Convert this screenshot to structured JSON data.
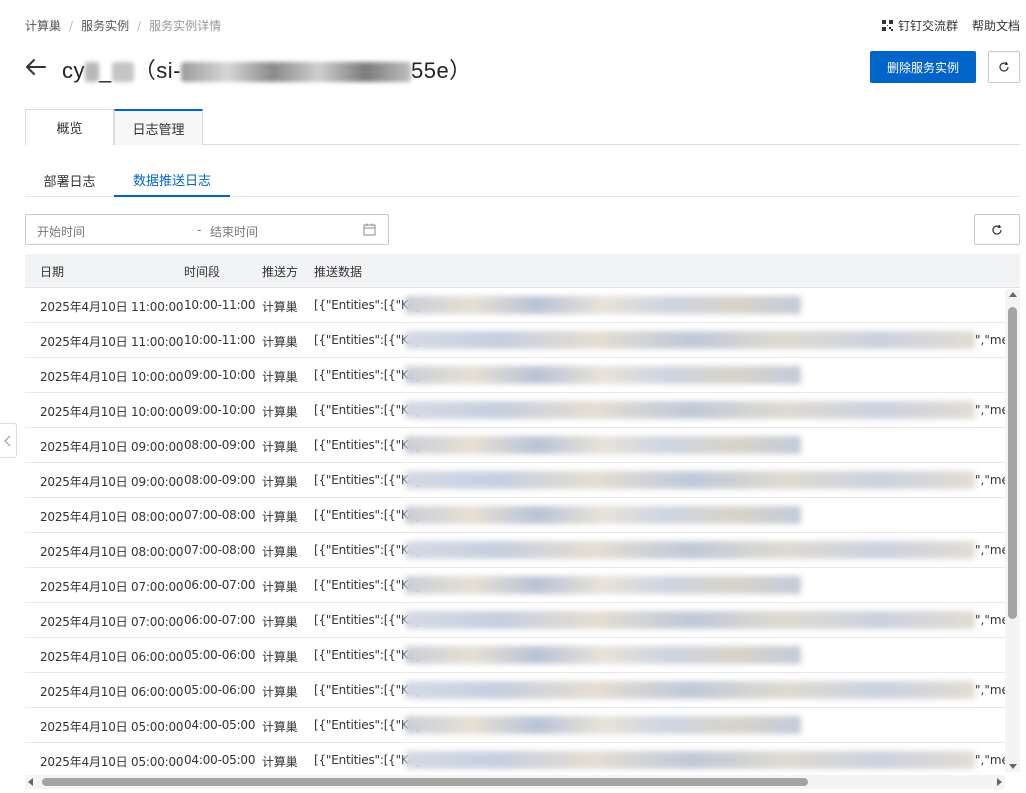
{
  "breadcrumb": {
    "items": [
      "计算巢",
      "服务实例",
      "服务实例详情"
    ],
    "separator": "/"
  },
  "top_links": {
    "dingtalk": "钉钉交流群",
    "help": "帮助文档"
  },
  "header": {
    "title_prefix": "cy",
    "title_mid": "_",
    "title_open": "（si-",
    "title_suffix": "55e）",
    "delete_button": "删除服务实例"
  },
  "main_tabs": [
    {
      "label": "概览",
      "active": false
    },
    {
      "label": "日志管理",
      "active": true
    }
  ],
  "sub_tabs": [
    {
      "label": "部署日志",
      "active": false
    },
    {
      "label": "数据推送日志",
      "active": true
    }
  ],
  "filter": {
    "start_placeholder": "开始时间",
    "separator": "-",
    "end_placeholder": "结束时间"
  },
  "table": {
    "headers": [
      "日期",
      "时间段",
      "推送方",
      "推送数据"
    ],
    "rows": [
      {
        "date": "2025年4月10日 11:00:00",
        "period": "10:00-11:00",
        "sender": "计算巢",
        "data": "[{\"Entities\":[{\"Key",
        "tail": ""
      },
      {
        "date": "2025年4月10日 11:00:00",
        "period": "10:00-11:00",
        "sender": "计算巢",
        "data": "[{\"Entities\":[{\"Key",
        "tail": "\",\"met"
      },
      {
        "date": "2025年4月10日 10:00:00",
        "period": "09:00-10:00",
        "sender": "计算巢",
        "data": "[{\"Entities\":[{\"Key",
        "tail": ""
      },
      {
        "date": "2025年4月10日 10:00:00",
        "period": "09:00-10:00",
        "sender": "计算巢",
        "data": "[{\"Entities\":[{\"Key",
        "tail": "\",\"met"
      },
      {
        "date": "2025年4月10日 09:00:00",
        "period": "08:00-09:00",
        "sender": "计算巢",
        "data": "[{\"Entities\":[{\"Key",
        "tail": ""
      },
      {
        "date": "2025年4月10日 09:00:00",
        "period": "08:00-09:00",
        "sender": "计算巢",
        "data": "[{\"Entities\":[{\"Key",
        "tail": "\",\"met"
      },
      {
        "date": "2025年4月10日 08:00:00",
        "period": "07:00-08:00",
        "sender": "计算巢",
        "data": "[{\"Entities\":[{\"Key",
        "tail": ""
      },
      {
        "date": "2025年4月10日 08:00:00",
        "period": "07:00-08:00",
        "sender": "计算巢",
        "data": "[{\"Entities\":[{\"Key",
        "tail": "\",\"met"
      },
      {
        "date": "2025年4月10日 07:00:00",
        "period": "06:00-07:00",
        "sender": "计算巢",
        "data": "[{\"Entities\":[{\"Key",
        "tail": ""
      },
      {
        "date": "2025年4月10日 07:00:00",
        "period": "06:00-07:00",
        "sender": "计算巢",
        "data": "[{\"Entities\":[{\"Key",
        "tail": "\",\"met"
      },
      {
        "date": "2025年4月10日 06:00:00",
        "period": "05:00-06:00",
        "sender": "计算巢",
        "data": "[{\"Entities\":[{\"Key",
        "tail": ""
      },
      {
        "date": "2025年4月10日 06:00:00",
        "period": "05:00-06:00",
        "sender": "计算巢",
        "data": "[{\"Entities\":[{\"Key",
        "tail": "\",\"met"
      },
      {
        "date": "2025年4月10日 05:00:00",
        "period": "04:00-05:00",
        "sender": "计算巢",
        "data": "[{\"Entities\":[{\"Key",
        "tail": ""
      },
      {
        "date": "2025年4月10日 05:00:00",
        "period": "04:00-05:00",
        "sender": "计算巢",
        "data": "[{\"Entities\":[{\"Key",
        "tail": "\",\"met"
      }
    ]
  },
  "colors": {
    "primary": "#0064c8",
    "header_bg": "#f2f3f5",
    "border": "#dcdcdc"
  },
  "icons": {
    "back": "arrow-left-icon",
    "refresh": "refresh-icon",
    "calendar": "calendar-icon",
    "dingtalk": "qr-icon",
    "collapse": "chevron-left-icon"
  }
}
